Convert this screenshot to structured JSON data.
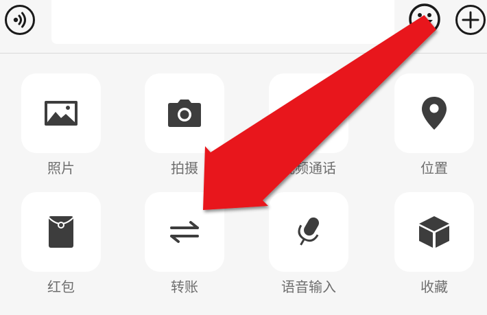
{
  "input_bar": {
    "voice_icon": "voice-icon",
    "message_placeholder": "",
    "emoji_icon": "emoji-icon",
    "plus_icon": "plus-icon"
  },
  "actions": [
    {
      "label": "照片",
      "icon": "photo-icon"
    },
    {
      "label": "拍摄",
      "icon": "camera-icon"
    },
    {
      "label": "视频通话",
      "icon": "video-call-icon"
    },
    {
      "label": "位置",
      "icon": "location-icon"
    },
    {
      "label": "红包",
      "icon": "red-packet-icon"
    },
    {
      "label": "转账",
      "icon": "transfer-icon"
    },
    {
      "label": "语音输入",
      "icon": "microphone-icon"
    },
    {
      "label": "收藏",
      "icon": "favorites-icon"
    }
  ],
  "annotation": {
    "arrow_color": "#e8161b",
    "icon_color": "#3d3d3d"
  }
}
